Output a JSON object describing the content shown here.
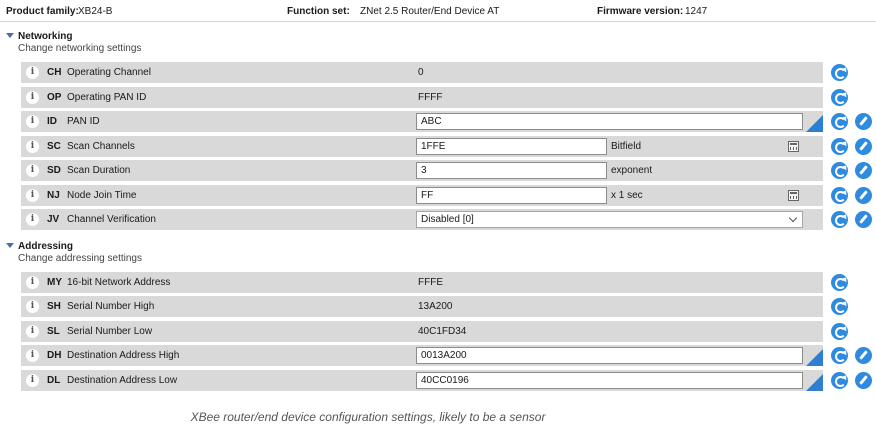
{
  "header": {
    "product_family_label": "Product family:",
    "product_family_value": "XB24-B",
    "function_set_label": "Function set:",
    "function_set_value": "ZNet 2.5 Router/End Device AT",
    "firmware_label": "Firmware version:",
    "firmware_value": "1247"
  },
  "networking": {
    "title": "Networking",
    "subtitle": "Change networking settings",
    "rows": [
      {
        "code": "CH",
        "name": "Operating Channel",
        "value": "0"
      },
      {
        "code": "OP",
        "name": "Operating PAN ID",
        "value": "FFFF"
      },
      {
        "code": "ID",
        "name": "PAN ID",
        "value": "ABC"
      },
      {
        "code": "SC",
        "name": "Scan Channels",
        "value": "1FFE",
        "unit": "Bitfield"
      },
      {
        "code": "SD",
        "name": "Scan Duration",
        "value": "3",
        "unit": "exponent"
      },
      {
        "code": "NJ",
        "name": "Node Join Time",
        "value": "FF",
        "unit": "x 1 sec"
      },
      {
        "code": "JV",
        "name": "Channel Verification",
        "value": "Disabled [0]"
      }
    ]
  },
  "addressing": {
    "title": "Addressing",
    "subtitle": "Change addressing settings",
    "rows": [
      {
        "code": "MY",
        "name": "16-bit Network Address",
        "value": "FFFE"
      },
      {
        "code": "SH",
        "name": "Serial Number High",
        "value": "13A200"
      },
      {
        "code": "SL",
        "name": "Serial Number Low",
        "value": "40C1FD34"
      },
      {
        "code": "DH",
        "name": "Destination Address High",
        "value": "0013A200"
      },
      {
        "code": "DL",
        "name": "Destination Address Low",
        "value": "40CC0196"
      }
    ]
  },
  "info_glyph": "i",
  "icons": {
    "info": "info-icon",
    "read": "refresh-icon",
    "write": "pencil-icon",
    "calculator": "calculator-icon",
    "collapse": "triangle-down-icon"
  },
  "colors": {
    "accent": "#2e8be0",
    "row_bg": "#d9d9d9",
    "modified_corner": "#2e7fd1"
  },
  "caption": "XBee router/end device configuration settings, likely to be a sensor"
}
